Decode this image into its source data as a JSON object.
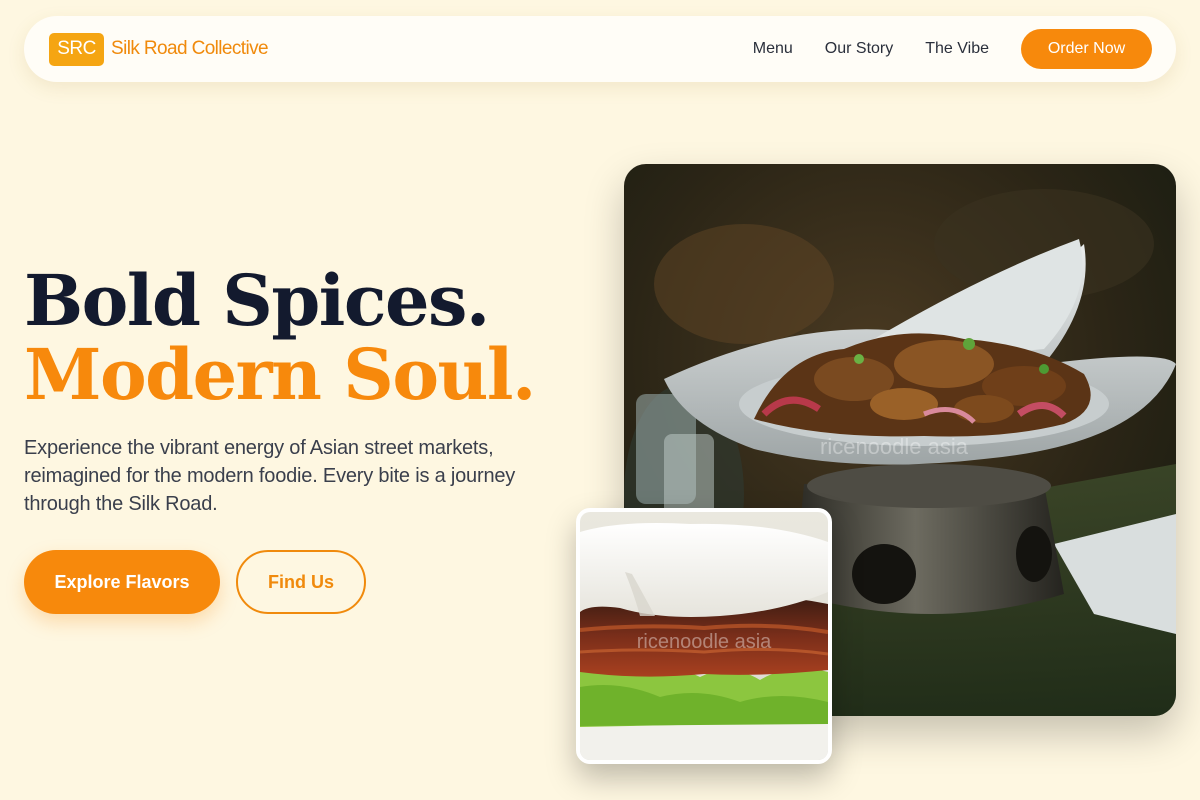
{
  "brand": {
    "logo_text": "SRC",
    "name": "Silk Road Collective"
  },
  "nav": {
    "links": [
      "Menu",
      "Our Story",
      "The Vibe"
    ],
    "cta": "Order Now"
  },
  "hero": {
    "headline_line1": "Bold Spices.",
    "headline_line2": "Modern Soul.",
    "subtitle": "Experience the vibrant energy of Asian street markets, reimagined for the modern foodie. Every bite is a journey through the Silk Road.",
    "primary_button": "Explore Flavors",
    "secondary_button": "Find Us"
  },
  "images": {
    "main_watermark": "ricenoodle asia",
    "thumb_watermark": "ricenoodle asia"
  },
  "colors": {
    "accent": "#f7890c",
    "logo_badge": "#f5a512",
    "headline_dark": "#131a2e",
    "background": "#fef7e1"
  }
}
